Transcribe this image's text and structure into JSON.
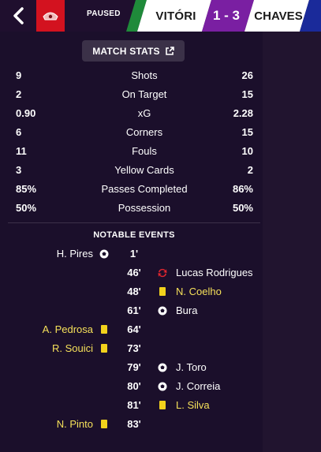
{
  "header": {
    "status": "PAUSED",
    "home_team": "VITÓRI",
    "score": "1 - 3",
    "away_team": "CHAVES",
    "colors": {
      "home_badge": "#d3121f",
      "home_stripe_green": "#1f8a3a",
      "score_bg": "#7a1fa2",
      "away_stripe_blue": "#1a2a9a"
    }
  },
  "match_stats": {
    "button_label": "MATCH STATS",
    "rows": [
      {
        "label": "Shots",
        "home": "9",
        "away": "26"
      },
      {
        "label": "On Target",
        "home": "2",
        "away": "15"
      },
      {
        "label": "xG",
        "home": "0.90",
        "away": "2.28"
      },
      {
        "label": "Corners",
        "home": "6",
        "away": "15"
      },
      {
        "label": "Fouls",
        "home": "11",
        "away": "10"
      },
      {
        "label": "Yellow Cards",
        "home": "3",
        "away": "2"
      },
      {
        "label": "Passes Completed",
        "home": "85%",
        "away": "86%"
      },
      {
        "label": "Possession",
        "home": "50%",
        "away": "50%"
      }
    ]
  },
  "events": {
    "title": "NOTABLE EVENTS",
    "items": [
      {
        "minute": "1'",
        "side": "home",
        "player": "H. Pires",
        "icon": "goal-icon"
      },
      {
        "minute": "46'",
        "side": "away",
        "player": "Lucas Rodrigues",
        "icon": "substitution-icon"
      },
      {
        "minute": "48'",
        "side": "away",
        "player": "N. Coelho",
        "icon": "yellow-card-icon"
      },
      {
        "minute": "61'",
        "side": "away",
        "player": "Bura",
        "icon": "goal-icon"
      },
      {
        "minute": "64'",
        "side": "home",
        "player": "A. Pedrosa",
        "icon": "yellow-card-icon"
      },
      {
        "minute": "73'",
        "side": "home",
        "player": "R. Souici",
        "icon": "yellow-card-icon"
      },
      {
        "minute": "79'",
        "side": "away",
        "player": "J. Toro",
        "icon": "goal-icon"
      },
      {
        "minute": "80'",
        "side": "away",
        "player": "J. Correia",
        "icon": "goal-icon"
      },
      {
        "minute": "81'",
        "side": "away",
        "player": "L. Silva",
        "icon": "yellow-card-icon"
      },
      {
        "minute": "83'",
        "side": "home",
        "player": "N. Pinto",
        "icon": "yellow-card-icon"
      }
    ]
  }
}
